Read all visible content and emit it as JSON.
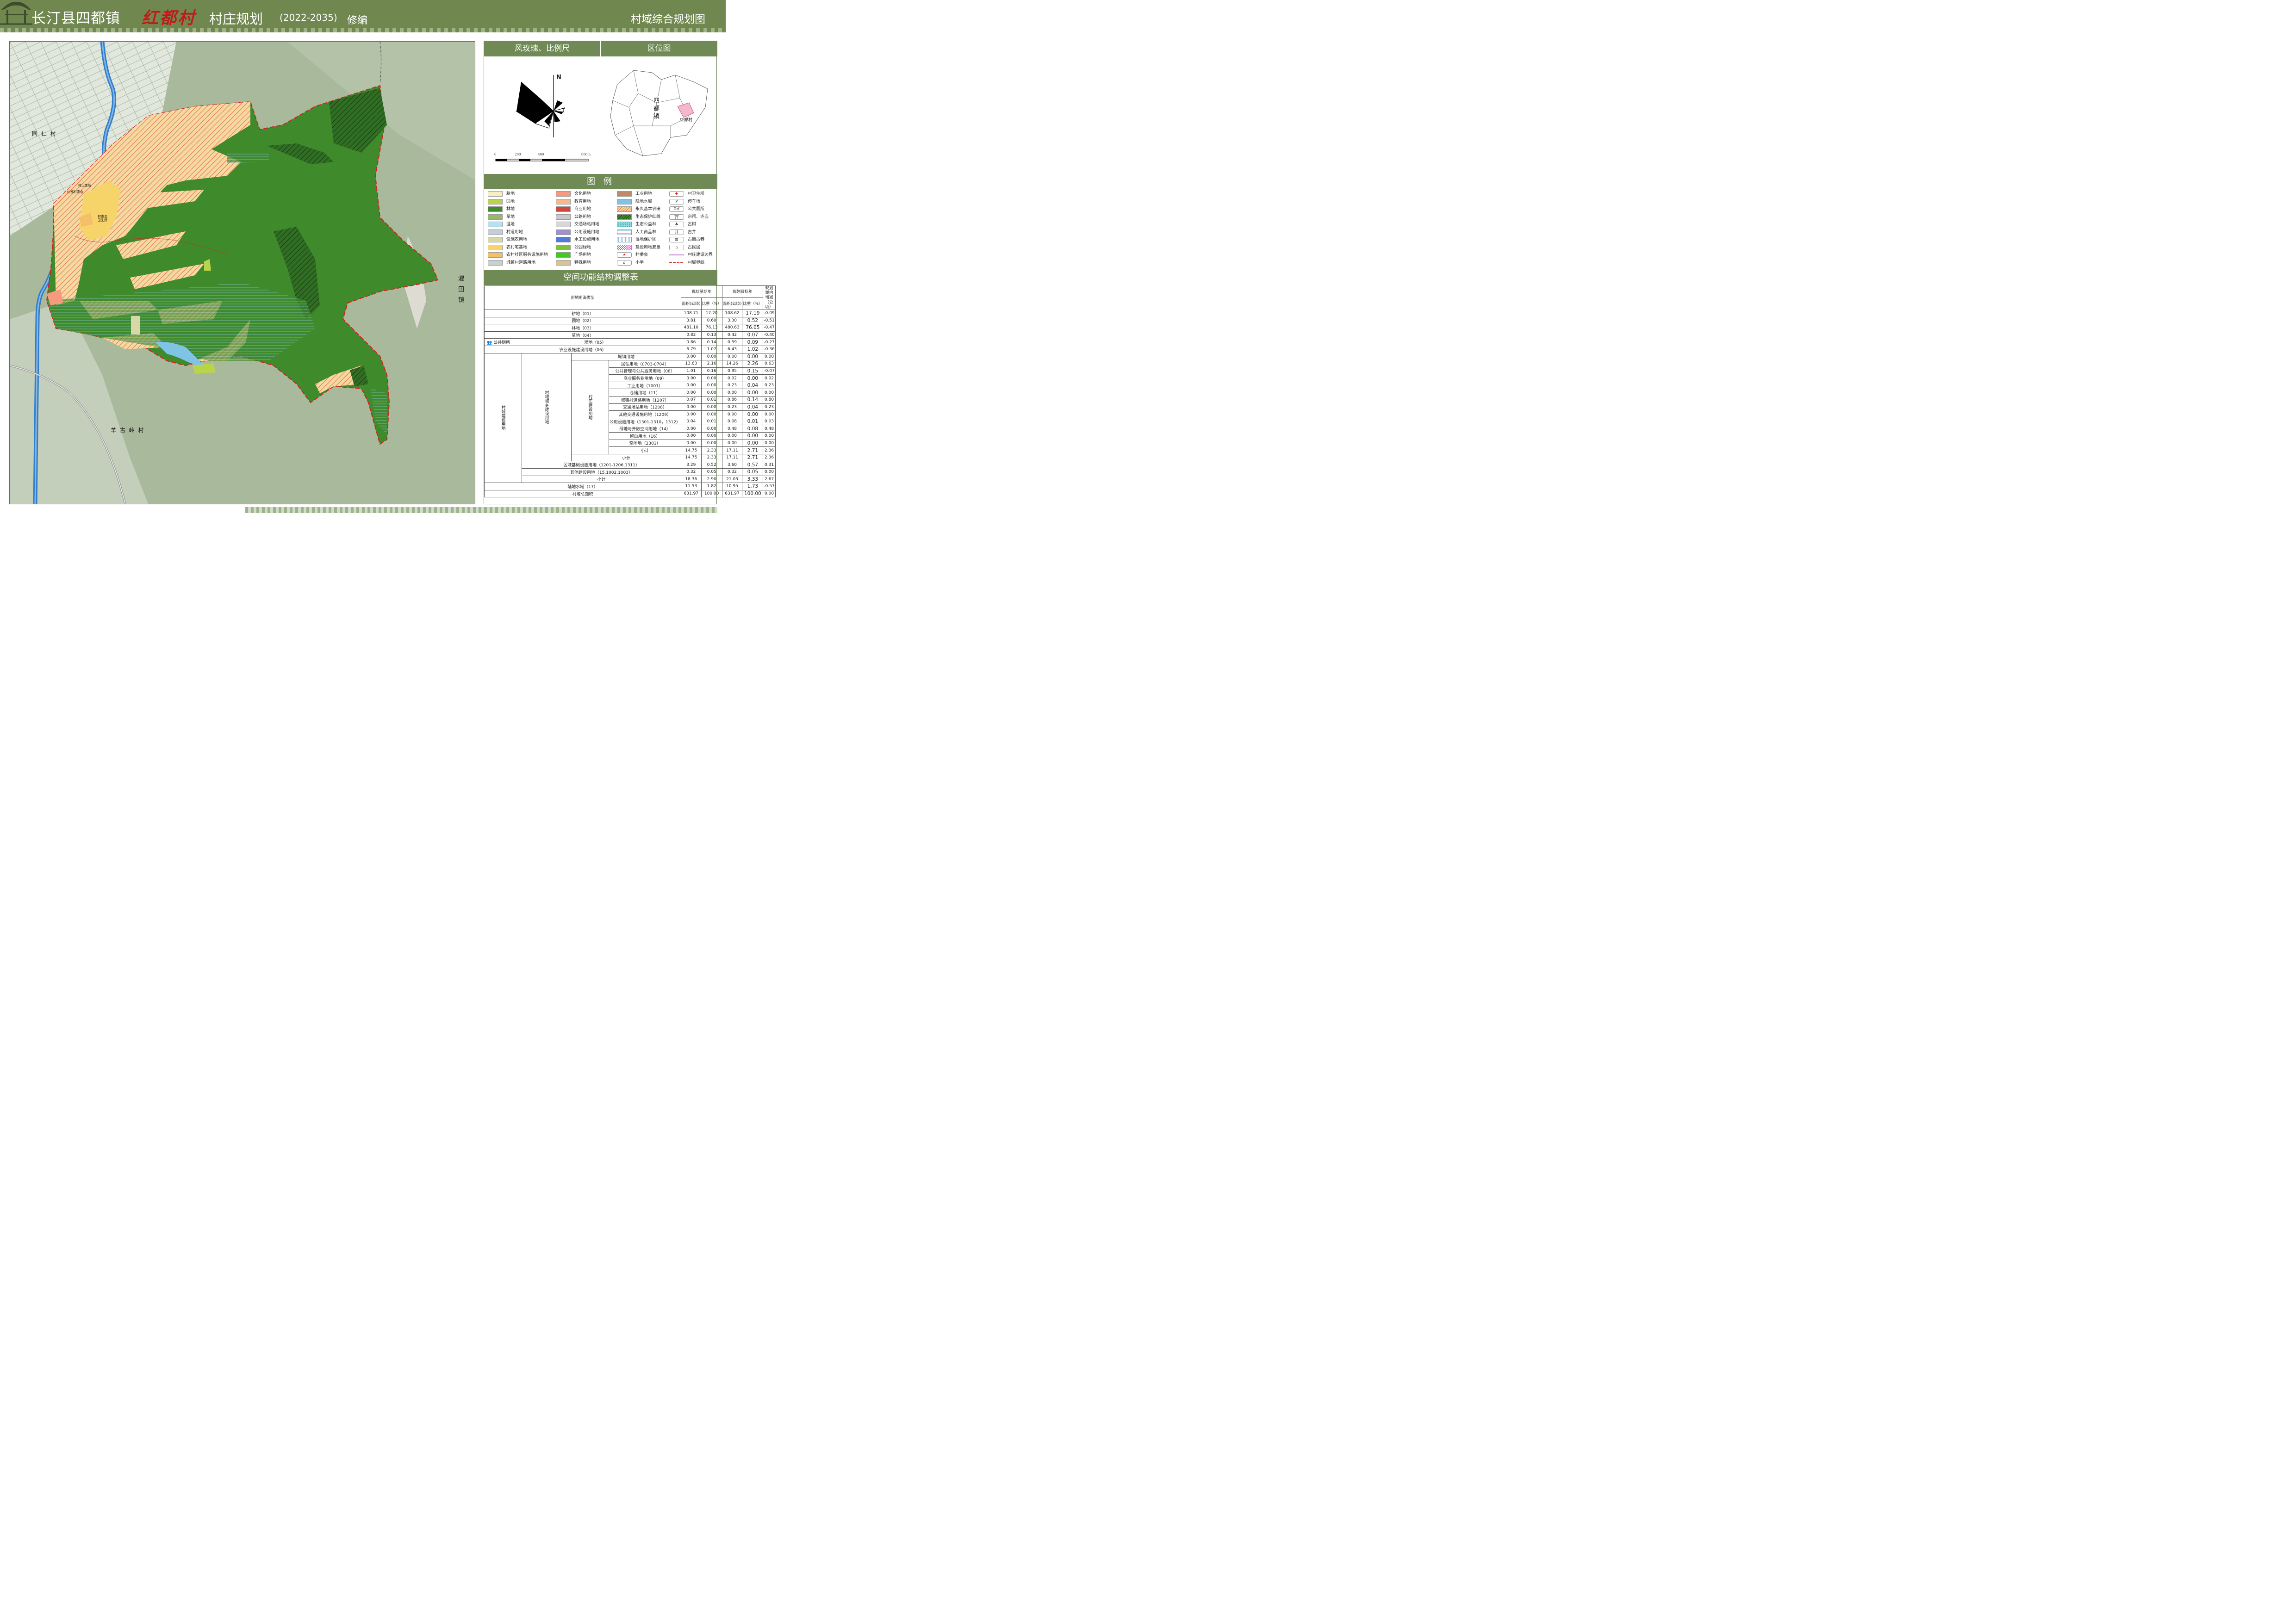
{
  "header": {
    "title_prefix": "长汀县四都镇",
    "village_name": "红都村",
    "title_main": "村庄规划",
    "title_years": "(2022-2035)",
    "title_suffix": "修编",
    "map_type": "村域综合规划图"
  },
  "map": {
    "labels": {
      "tongren": "同 仁 村",
      "yanggulingcun": "羊 古 岭 村",
      "guantian": "濯田镇"
    },
    "poi_labels": [
      "村卫生所",
      "红都村委会",
      "村委会",
      "卫生所"
    ]
  },
  "panels": {
    "compass_title": "风玫瑰、比例尺",
    "location_title": "区位图",
    "north_label": "N",
    "scale_ticks": [
      "0",
      "200",
      "400",
      "800m"
    ],
    "location_labels": {
      "town": "四都镇",
      "village": "红都村"
    },
    "legend_title": "图 例",
    "table_title": "空间功能结构调整表"
  },
  "legend": [
    {
      "label": "耕地",
      "color": "#f7efc4",
      "pattern": "solid"
    },
    {
      "label": "园地",
      "color": "#b9d44a",
      "pattern": "solid"
    },
    {
      "label": "林地",
      "color": "#3f8b2c",
      "pattern": "solid"
    },
    {
      "label": "草地",
      "color": "#98b86e",
      "pattern": "solid"
    },
    {
      "label": "湿地",
      "color": "#b8e0f0",
      "pattern": "solid"
    },
    {
      "label": "村道用地",
      "color": "#c6ced3",
      "pattern": "solid"
    },
    {
      "label": "设施农用地",
      "color": "#d8d7a8",
      "pattern": "solid"
    },
    {
      "label": "农村宅基地",
      "color": "#f7d46a",
      "pattern": "solid"
    },
    {
      "label": "农村社区服务设施用地",
      "color": "#f4bf6a",
      "pattern": "solid"
    },
    {
      "label": "城镇村道路用地",
      "color": "#c9d0cf",
      "pattern": "solid"
    },
    {
      "label": "文化用地",
      "color": "#f59a7e",
      "pattern": "solid"
    },
    {
      "label": "教育用地",
      "color": "#f7b98a",
      "pattern": "solid"
    },
    {
      "label": "商业用地",
      "color": "#d2473a",
      "pattern": "solid"
    },
    {
      "label": "公路用地",
      "color": "#c9c9c9",
      "pattern": "solid"
    },
    {
      "label": "交通场站用地",
      "color": "#d7d7d7",
      "pattern": "solid"
    },
    {
      "label": "公用设施用地",
      "color": "#9f92c9",
      "pattern": "solid"
    },
    {
      "label": "水工设施用地",
      "color": "#4d7be0",
      "pattern": "solid"
    },
    {
      "label": "公园绿地",
      "color": "#7cc33a",
      "pattern": "solid"
    },
    {
      "label": "广场用地",
      "color": "#3ecb1f",
      "pattern": "solid"
    },
    {
      "label": "特殊用地",
      "color": "#d4c69a",
      "pattern": "solid"
    },
    {
      "label": "工业用地",
      "color": "#bf8a6a",
      "pattern": "solid"
    },
    {
      "label": "陆地水域",
      "color": "#7fc3e5",
      "pattern": "solid"
    },
    {
      "label": "永久基本农田",
      "color": "#f6d9a2",
      "pattern": "hatch-red"
    },
    {
      "label": "生态保护红线",
      "color": "#3f8b2c",
      "pattern": "hatch-black"
    },
    {
      "label": "生态公益林",
      "color": "#8fd9e0",
      "pattern": "dots"
    },
    {
      "label": "人工商品林",
      "color": "#8cc4e8",
      "pattern": "hlines"
    },
    {
      "label": "湿地保护区",
      "color": "#8ac0e8",
      "pattern": "vlines"
    },
    {
      "label": "建设用地复垦",
      "color": "#e05ad8",
      "pattern": "check"
    },
    {
      "label": "村委会",
      "color": "#d32020",
      "pattern": "icon-star"
    },
    {
      "label": "小学",
      "color": "#333333",
      "pattern": "icon-school"
    },
    {
      "label": "村卫生所",
      "color": "#d32020",
      "pattern": "icon-cross"
    },
    {
      "label": "停车场",
      "color": "#333333",
      "pattern": "icon-p"
    },
    {
      "label": "公共厕所",
      "color": "#333333",
      "pattern": "icon-wc"
    },
    {
      "label": "宗祠、寺庙",
      "color": "#333333",
      "pattern": "icon-temple"
    },
    {
      "label": "古树",
      "color": "#333333",
      "pattern": "icon-tree"
    },
    {
      "label": "古井",
      "color": "#333333",
      "pattern": "icon-well"
    },
    {
      "label": "古街古巷",
      "color": "#333333",
      "pattern": "icon-street"
    },
    {
      "label": "古民居",
      "color": "#333333",
      "pattern": "icon-house"
    },
    {
      "label": "村庄建设边界",
      "color": "#c07fd0",
      "pattern": "line-purple"
    },
    {
      "label": "村域界线",
      "color": "#d32020",
      "pattern": "line-dash"
    }
  ],
  "table": {
    "head": {
      "type": "用地用海类型",
      "base_year": "现状基期年",
      "target_year": "规划目标年",
      "change": "规划期内增减（公顷）",
      "area": "面积(公顷)",
      "ratio": "比重（%）"
    },
    "group_labels": {
      "construction": "村域建设用地",
      "urban_rural": "村域城乡建设用地",
      "village": "村庄建设用地",
      "toilet_overlay": "公共厕所"
    },
    "top_rows": [
      [
        "耕地（01）",
        "108.71",
        "17.20",
        "108.62",
        "17.19",
        "-0.09"
      ],
      [
        "园地（02）",
        "3.81",
        "0.60",
        "3.30",
        "0.52",
        "-0.51"
      ],
      [
        "林地（03）",
        "481.10",
        "76.13",
        "480.63",
        "76.05",
        "-0.47"
      ],
      [
        "草地（04）",
        "0.82",
        "0.13",
        "0.42",
        "0.07",
        "-0.40"
      ],
      [
        "湿地（05）",
        "0.86",
        "0.14",
        "0.59",
        "0.09",
        "-0.27"
      ],
      [
        "农业设施建设用地（06）",
        "6.79",
        "1.07",
        "6.43",
        "1.02",
        "-0.36"
      ]
    ],
    "town_row": [
      "城镇用地",
      "0.00",
      "0.00",
      "0.00",
      "0.00",
      "0.00"
    ],
    "village_rows": [
      [
        "居住用地（0703-0704）",
        "13.63",
        "2.16",
        "14.26",
        "2.26",
        "0.63"
      ],
      [
        "公共管理与公共服务用地（08）",
        "1.01",
        "0.16",
        "0.95",
        "0.15",
        "-0.07"
      ],
      [
        "商业服务业用地（09）",
        "0.00",
        "0.00",
        "0.02",
        "0.00",
        "0.02"
      ],
      [
        "工业用地（1001）",
        "0.00",
        "0.00",
        "0.23",
        "0.04",
        "0.23"
      ],
      [
        "仓储用地（11）",
        "0.00",
        "0.00",
        "0.00",
        "0.00",
        "0.00"
      ],
      [
        "城镇村道路用地（1207）",
        "0.07",
        "0.01",
        "0.86",
        "0.14",
        "0.80"
      ],
      [
        "交通场站用地（1208）",
        "0.00",
        "0.00",
        "0.23",
        "0.04",
        "0.23"
      ],
      [
        "其他交通设施用地（1209）",
        "0.00",
        "0.00",
        "0.00",
        "0.00",
        "0.00"
      ],
      [
        "公用设施用地（1301-1310，1312）",
        "0.04",
        "0.01",
        "0.08",
        "0.01",
        "0.03"
      ],
      [
        "绿地与开敞空间用地（14）",
        "0.00",
        "0.00",
        "0.48",
        "0.08",
        "0.48"
      ],
      [
        "留白用地（16）",
        "0.00",
        "0.00",
        "0.00",
        "0.00",
        "0.00"
      ],
      [
        "空闲地（2301）",
        "0.00",
        "0.00",
        "0.00",
        "0.00",
        "0.00"
      ],
      [
        "小计",
        "14.75",
        "2.33",
        "17.11",
        "2.71",
        "2.36"
      ]
    ],
    "urban_subtotal": [
      "小计",
      "14.75",
      "2.33",
      "17.11",
      "2.71",
      "2.36"
    ],
    "infra_rows": [
      [
        "区域基础设施用地（1201-1206,1311）",
        "3.29",
        "0.52",
        "3.60",
        "0.57",
        "0.31"
      ],
      [
        "其他建设用地（15,1002,1003）",
        "0.32",
        "0.05",
        "0.32",
        "0.05",
        "0.00"
      ],
      [
        "小计",
        "18.36",
        "2.90",
        "21.03",
        "3.33",
        "2.67"
      ]
    ],
    "bottom_rows": [
      [
        "陆地水域（17）",
        "11.53",
        "1.82",
        "10.95",
        "1.73",
        "-0.57"
      ],
      [
        "村域总面积",
        "631.97",
        "100.00",
        "631.97",
        "100.00",
        "0.00"
      ]
    ]
  }
}
